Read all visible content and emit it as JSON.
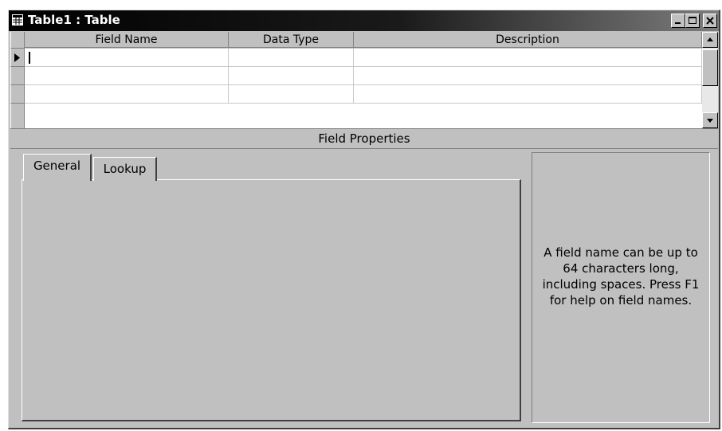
{
  "window": {
    "title": "Table1 : Table",
    "icon": "table-icon",
    "controls": [
      "minimize-icon",
      "maximize-icon",
      "close-icon"
    ]
  },
  "grid": {
    "columns": [
      "Field Name",
      "Data Type",
      "Description"
    ],
    "rows": [
      {
        "field_name": "",
        "data_type": "",
        "description": ""
      },
      {
        "field_name": "",
        "data_type": "",
        "description": ""
      },
      {
        "field_name": "",
        "data_type": "",
        "description": ""
      }
    ]
  },
  "field_properties": {
    "title": "Field Properties",
    "tabs": [
      "General",
      "Lookup"
    ],
    "active_tab": "General",
    "help_text": "A field name can be up to 64 characters long, including spaces.  Press F1 for help on field names."
  }
}
